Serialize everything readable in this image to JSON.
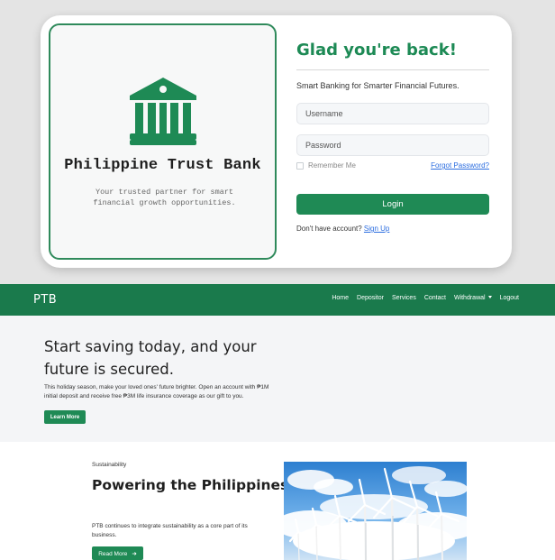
{
  "login": {
    "bank_name": "Philippine Trust Bank",
    "tagline": "Your trusted partner for smart financial growth opportunities.",
    "heading": "Glad you're back!",
    "subheading": "Smart Banking for Smarter Financial Futures.",
    "username_placeholder": "Username",
    "password_placeholder": "Password",
    "remember_label": "Remember Me",
    "forgot_link": "Forgot Password?",
    "login_button": "Login",
    "no_account_text": "Don't have account?",
    "signup_link": "Sign Up",
    "icon": "bank-building-icon",
    "accent_color": "#1f8a55"
  },
  "navbar": {
    "brand": "PTB",
    "links": [
      "Home",
      "Depositor",
      "Services",
      "Contact",
      "Withdrawal",
      "Logout"
    ],
    "bg_color": "#1a7a4c"
  },
  "hero": {
    "title": "Start saving today, and your future is secured.",
    "text": "This holiday season, make your loved ones' future brighter. Open an account with ₱1M initial deposit and receive free ₱3M life insurance coverage as our gift to you.",
    "button": "Learn More"
  },
  "sustainability": {
    "eyebrow": "Sustainability",
    "title": "Powering the Philippines' Energy Transition",
    "text": "PTB continues to integrate sustainability as a core part of its business.",
    "button": "Read More",
    "button_icon": "arrow-right-icon",
    "image": "wind-turbines-photo"
  }
}
